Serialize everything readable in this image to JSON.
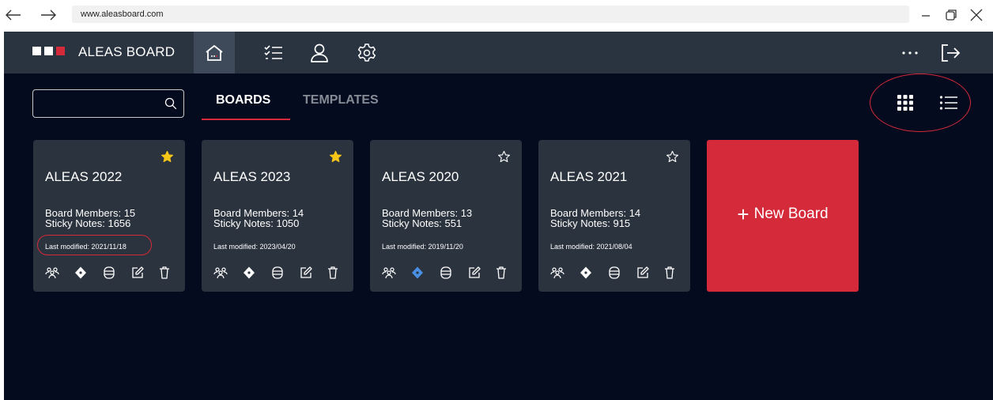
{
  "browser": {
    "url": "www.aleasboard.com"
  },
  "app": {
    "title": "ALEAS BOARD",
    "logo_colors": [
      "#ffffff",
      "#ffffff",
      "#d52a3a"
    ]
  },
  "search": {
    "value": "",
    "placeholder": ""
  },
  "tabs": {
    "boards": "BOARDS",
    "templates": "TEMPLATES"
  },
  "boards": [
    {
      "title": "ALEAS 2022",
      "members": "Board Members: 15",
      "notes": "Sticky Notes: 1656",
      "modified": "Last modified: 2021/11/18",
      "starred": true,
      "diamond_color": "#ffffff"
    },
    {
      "title": "ALEAS 2023",
      "members": "Board Members: 14",
      "notes": "Sticky Notes: 1050",
      "modified": "Last modified: 2023/04/20",
      "starred": true,
      "diamond_color": "#ffffff"
    },
    {
      "title": "ALEAS 2020",
      "members": "Board Members: 13",
      "notes": "Sticky Notes: 551",
      "modified": "Last modified: 2019/11/20",
      "starred": false,
      "diamond_color": "#4a90e2"
    },
    {
      "title": "ALEAS 2021",
      "members": "Board Members: 14",
      "notes": "Sticky Notes: 915",
      "modified": "Last modified: 2021/08/04",
      "starred": false,
      "diamond_color": "#ffffff"
    }
  ],
  "new_board": {
    "plus": "+",
    "label": "New Board"
  },
  "colors": {
    "accent": "#d52a3a",
    "star_filled": "#f5c518",
    "background": "#050b1f",
    "card": "#2b333e",
    "header": "#2a3340"
  },
  "icons": {
    "header": [
      "home-icon",
      "checklist-icon",
      "user-icon",
      "settings-icon",
      "more-icon",
      "logout-icon"
    ],
    "card_actions": [
      "members-icon",
      "diamond-icon",
      "database-icon",
      "edit-icon",
      "trash-icon"
    ]
  }
}
